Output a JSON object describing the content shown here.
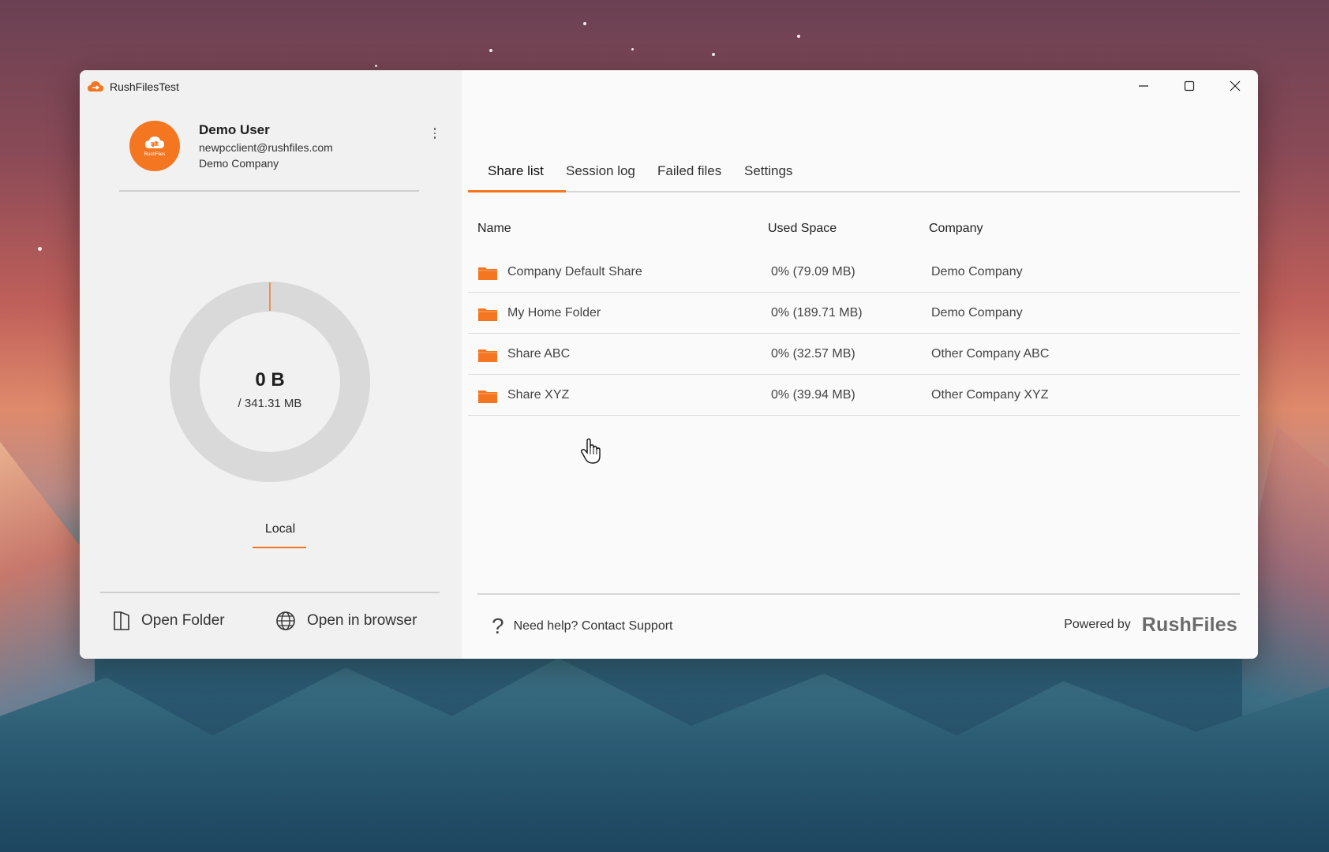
{
  "app": {
    "title": "RushFilesTest"
  },
  "window_controls": {
    "minimize_icon": "minimize-icon",
    "maximize_icon": "maximize-icon",
    "close_icon": "close-icon"
  },
  "profile": {
    "name": "Demo User",
    "email": "newpcclient@rushfiles.com",
    "company": "Demo Company",
    "avatar_brand": "RushFiles"
  },
  "storage": {
    "used": "0 B",
    "total": "/ 341.31 MB",
    "used_fraction": 0
  },
  "local_tab": {
    "label": "Local"
  },
  "actions": {
    "open_folder": "Open Folder",
    "open_browser": "Open in browser"
  },
  "tabs": [
    {
      "label": "Share list",
      "active": true
    },
    {
      "label": "Session log",
      "active": false
    },
    {
      "label": "Failed files",
      "active": false
    },
    {
      "label": "Settings",
      "active": false
    }
  ],
  "table": {
    "headers": {
      "name": "Name",
      "used_space": "Used Space",
      "company": "Company"
    },
    "rows": [
      {
        "name": "Company Default Share",
        "used": "0% (79.09 MB)",
        "company": "Demo Company"
      },
      {
        "name": "My Home Folder",
        "used": "0% (189.71 MB)",
        "company": "Demo Company"
      },
      {
        "name": "Share ABC",
        "used": "0% (32.57 MB)",
        "company": "Other Company ABC"
      },
      {
        "name": "Share XYZ",
        "used": "0% (39.94 MB)",
        "company": "Other Company XYZ"
      }
    ]
  },
  "footer": {
    "help": "Need help? Contact Support",
    "powered_label": "Powered by",
    "powered_brand": "RushFiles"
  },
  "colors": {
    "accent": "#f57621",
    "folder": "#f57621",
    "donut_track": "#d9d9d9"
  }
}
